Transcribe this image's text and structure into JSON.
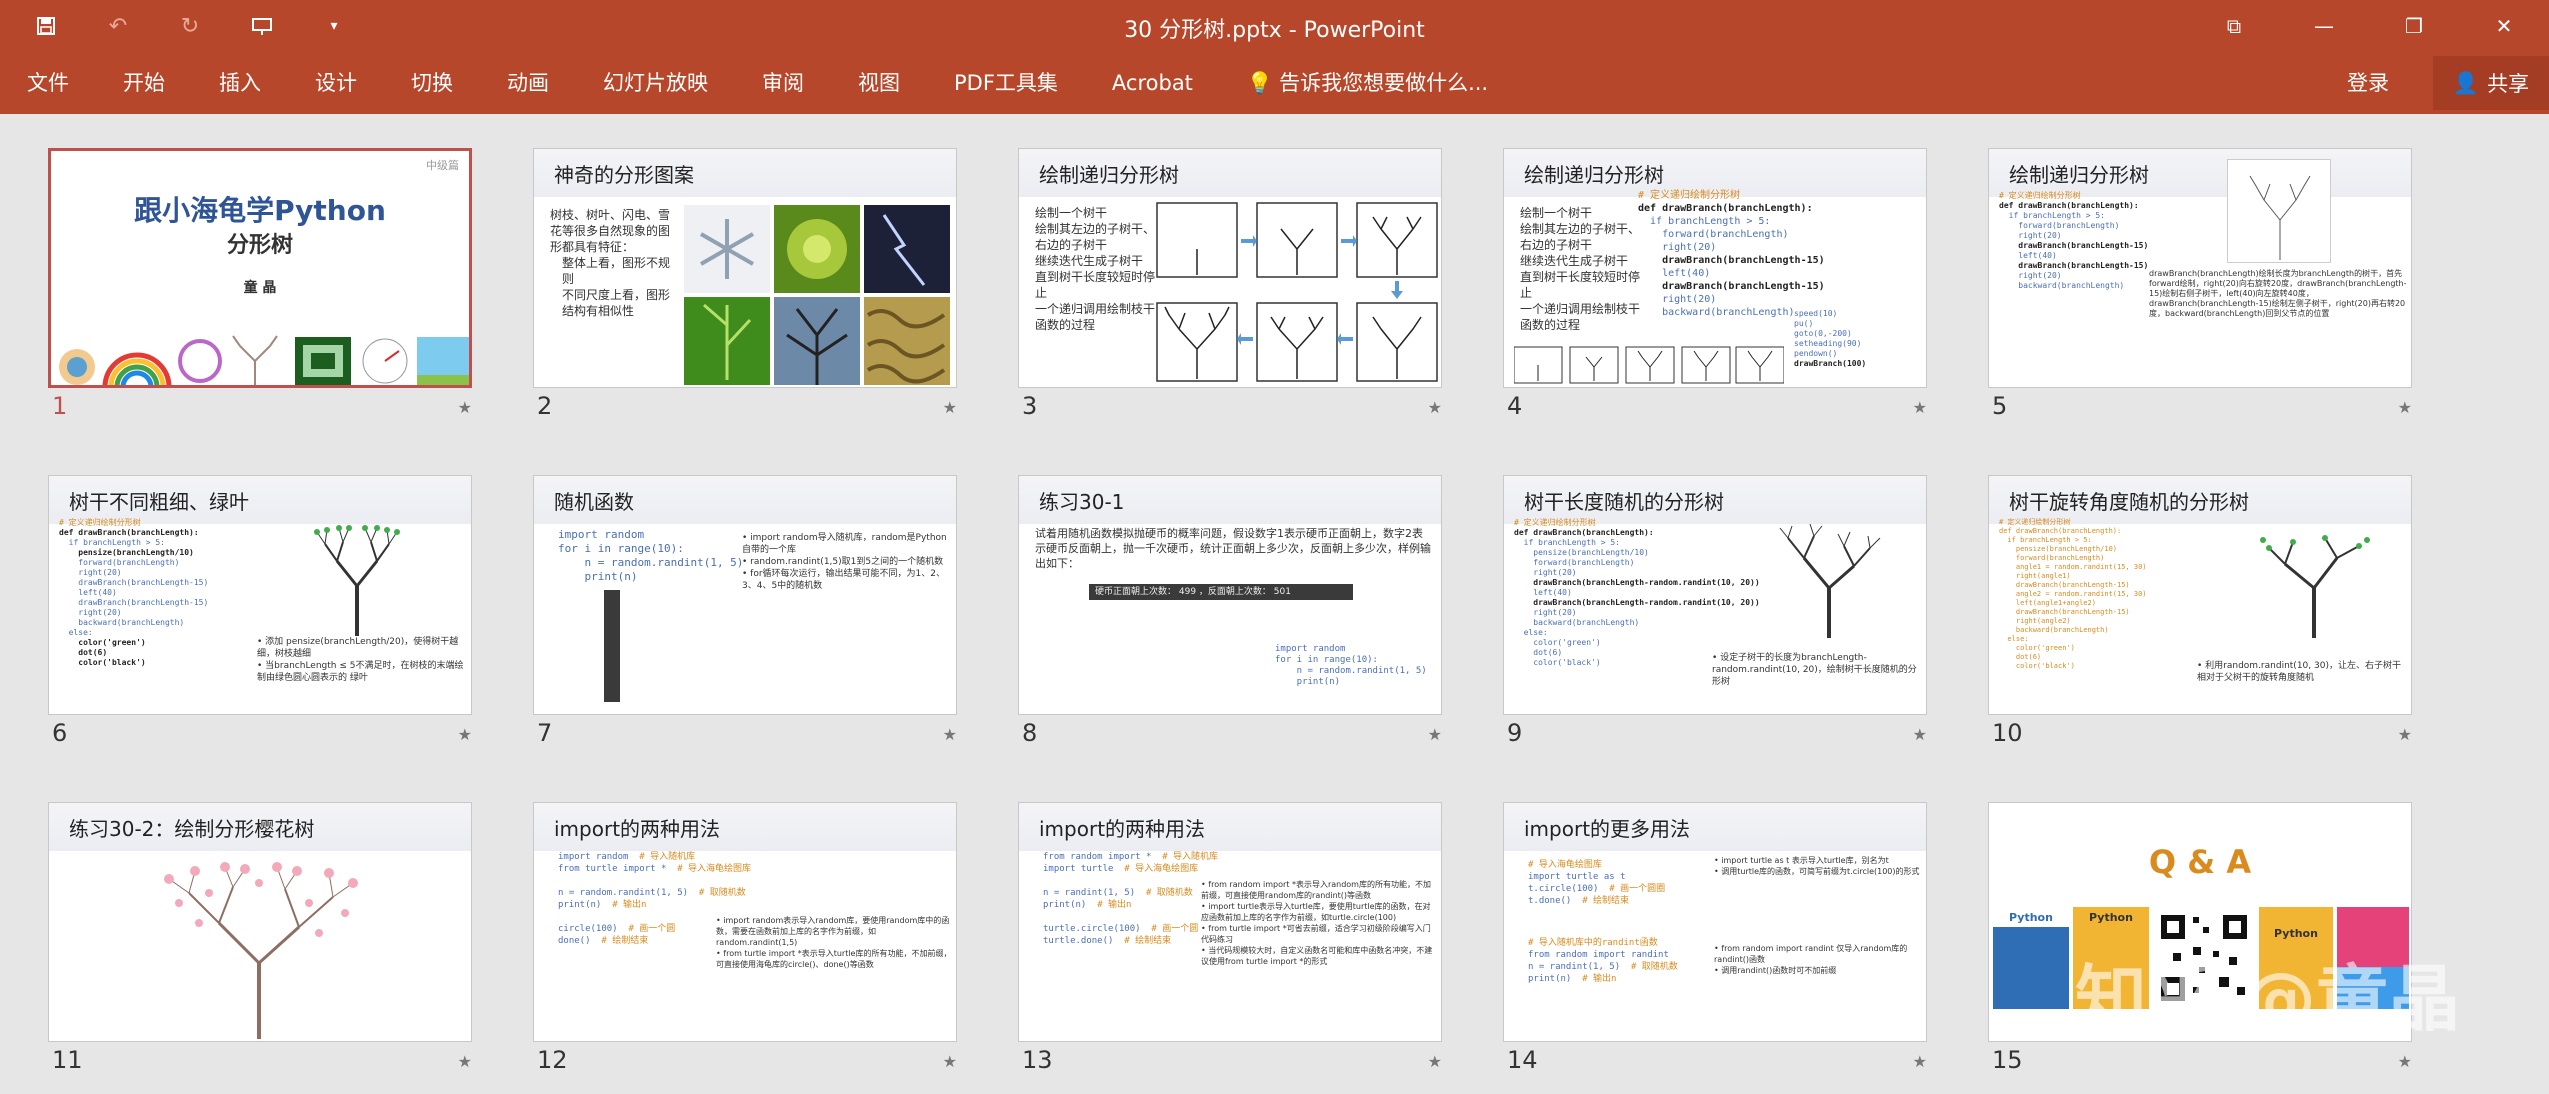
{
  "window": {
    "title": "30 分形树.pptx - PowerPoint"
  },
  "qat": {
    "save_icon": "save-icon",
    "undo_icon": "undo-icon",
    "redo_icon": "redo-icon",
    "present_icon": "present-icon",
    "customize_icon": "chevron-down-icon"
  },
  "ribbon": {
    "tabs": [
      "文件",
      "开始",
      "插入",
      "设计",
      "切换",
      "动画",
      "幻灯片放映",
      "审阅",
      "视图",
      "PDF工具集",
      "Acrobat"
    ],
    "tellme": "告诉我您想要做什么...",
    "signin": "登录",
    "share": "共享"
  },
  "colors": {
    "accent": "#b7472a",
    "selected_border": "#c0504d"
  },
  "slides": [
    {
      "num": "1",
      "title": "",
      "main": "跟小海龟学Python",
      "sub": "分形树",
      "author": "童 晶",
      "level": "中级篇"
    },
    {
      "num": "2",
      "title": "神奇的分形图案",
      "bullets": [
        "树枝、树叶、闪电、雪花等很多自然现象的图形都具有特征：",
        "整体上看，图形不规则",
        "不同尺度上看，图形结构有相似性"
      ]
    },
    {
      "num": "3",
      "title": "绘制递归分形树",
      "bullets": [
        "绘制一个树干",
        "绘制其左边的子树干、右边的子树干",
        "继续迭代生成子树干",
        "直到树干长度较短时停止",
        "一个递归调用绘制枝干函数的过程"
      ]
    },
    {
      "num": "4",
      "title": "绘制递归分形树",
      "bullets": [
        "绘制一个树干",
        "绘制其左边的子树干、右边的子树干",
        "继续迭代生成子树干",
        "直到树干长度较短时停止",
        "一个递归调用绘制枝干函数的过程"
      ]
    },
    {
      "num": "5",
      "title": "绘制递归分形树"
    },
    {
      "num": "6",
      "title": "树干不同粗细、绿叶"
    },
    {
      "num": "7",
      "title": "随机函数"
    },
    {
      "num": "8",
      "title": "练习30-1",
      "body": "试着用随机函数模拟抛硬币的概率问题，假设数字1表示硬币正面朝上，数字2表示硬币反面朝上，抛一千次硬币，统计正面朝上多少次，反面朝上多少次，样例输出如下：",
      "output": "硬币正面朝上次数： 499 ，反面朝上次数： 501"
    },
    {
      "num": "9",
      "title": "树干长度随机的分形树"
    },
    {
      "num": "10",
      "title": "树干旋转角度随机的分形树"
    },
    {
      "num": "11",
      "title": "练习30-2：绘制分形樱花树"
    },
    {
      "num": "12",
      "title": "import的两种用法"
    },
    {
      "num": "13",
      "title": "import的两种用法"
    },
    {
      "num": "14",
      "title": "import的更多用法"
    },
    {
      "num": "15",
      "title": "",
      "qa": "Q & A"
    }
  ],
  "watermark": "知乎 @童晶"
}
